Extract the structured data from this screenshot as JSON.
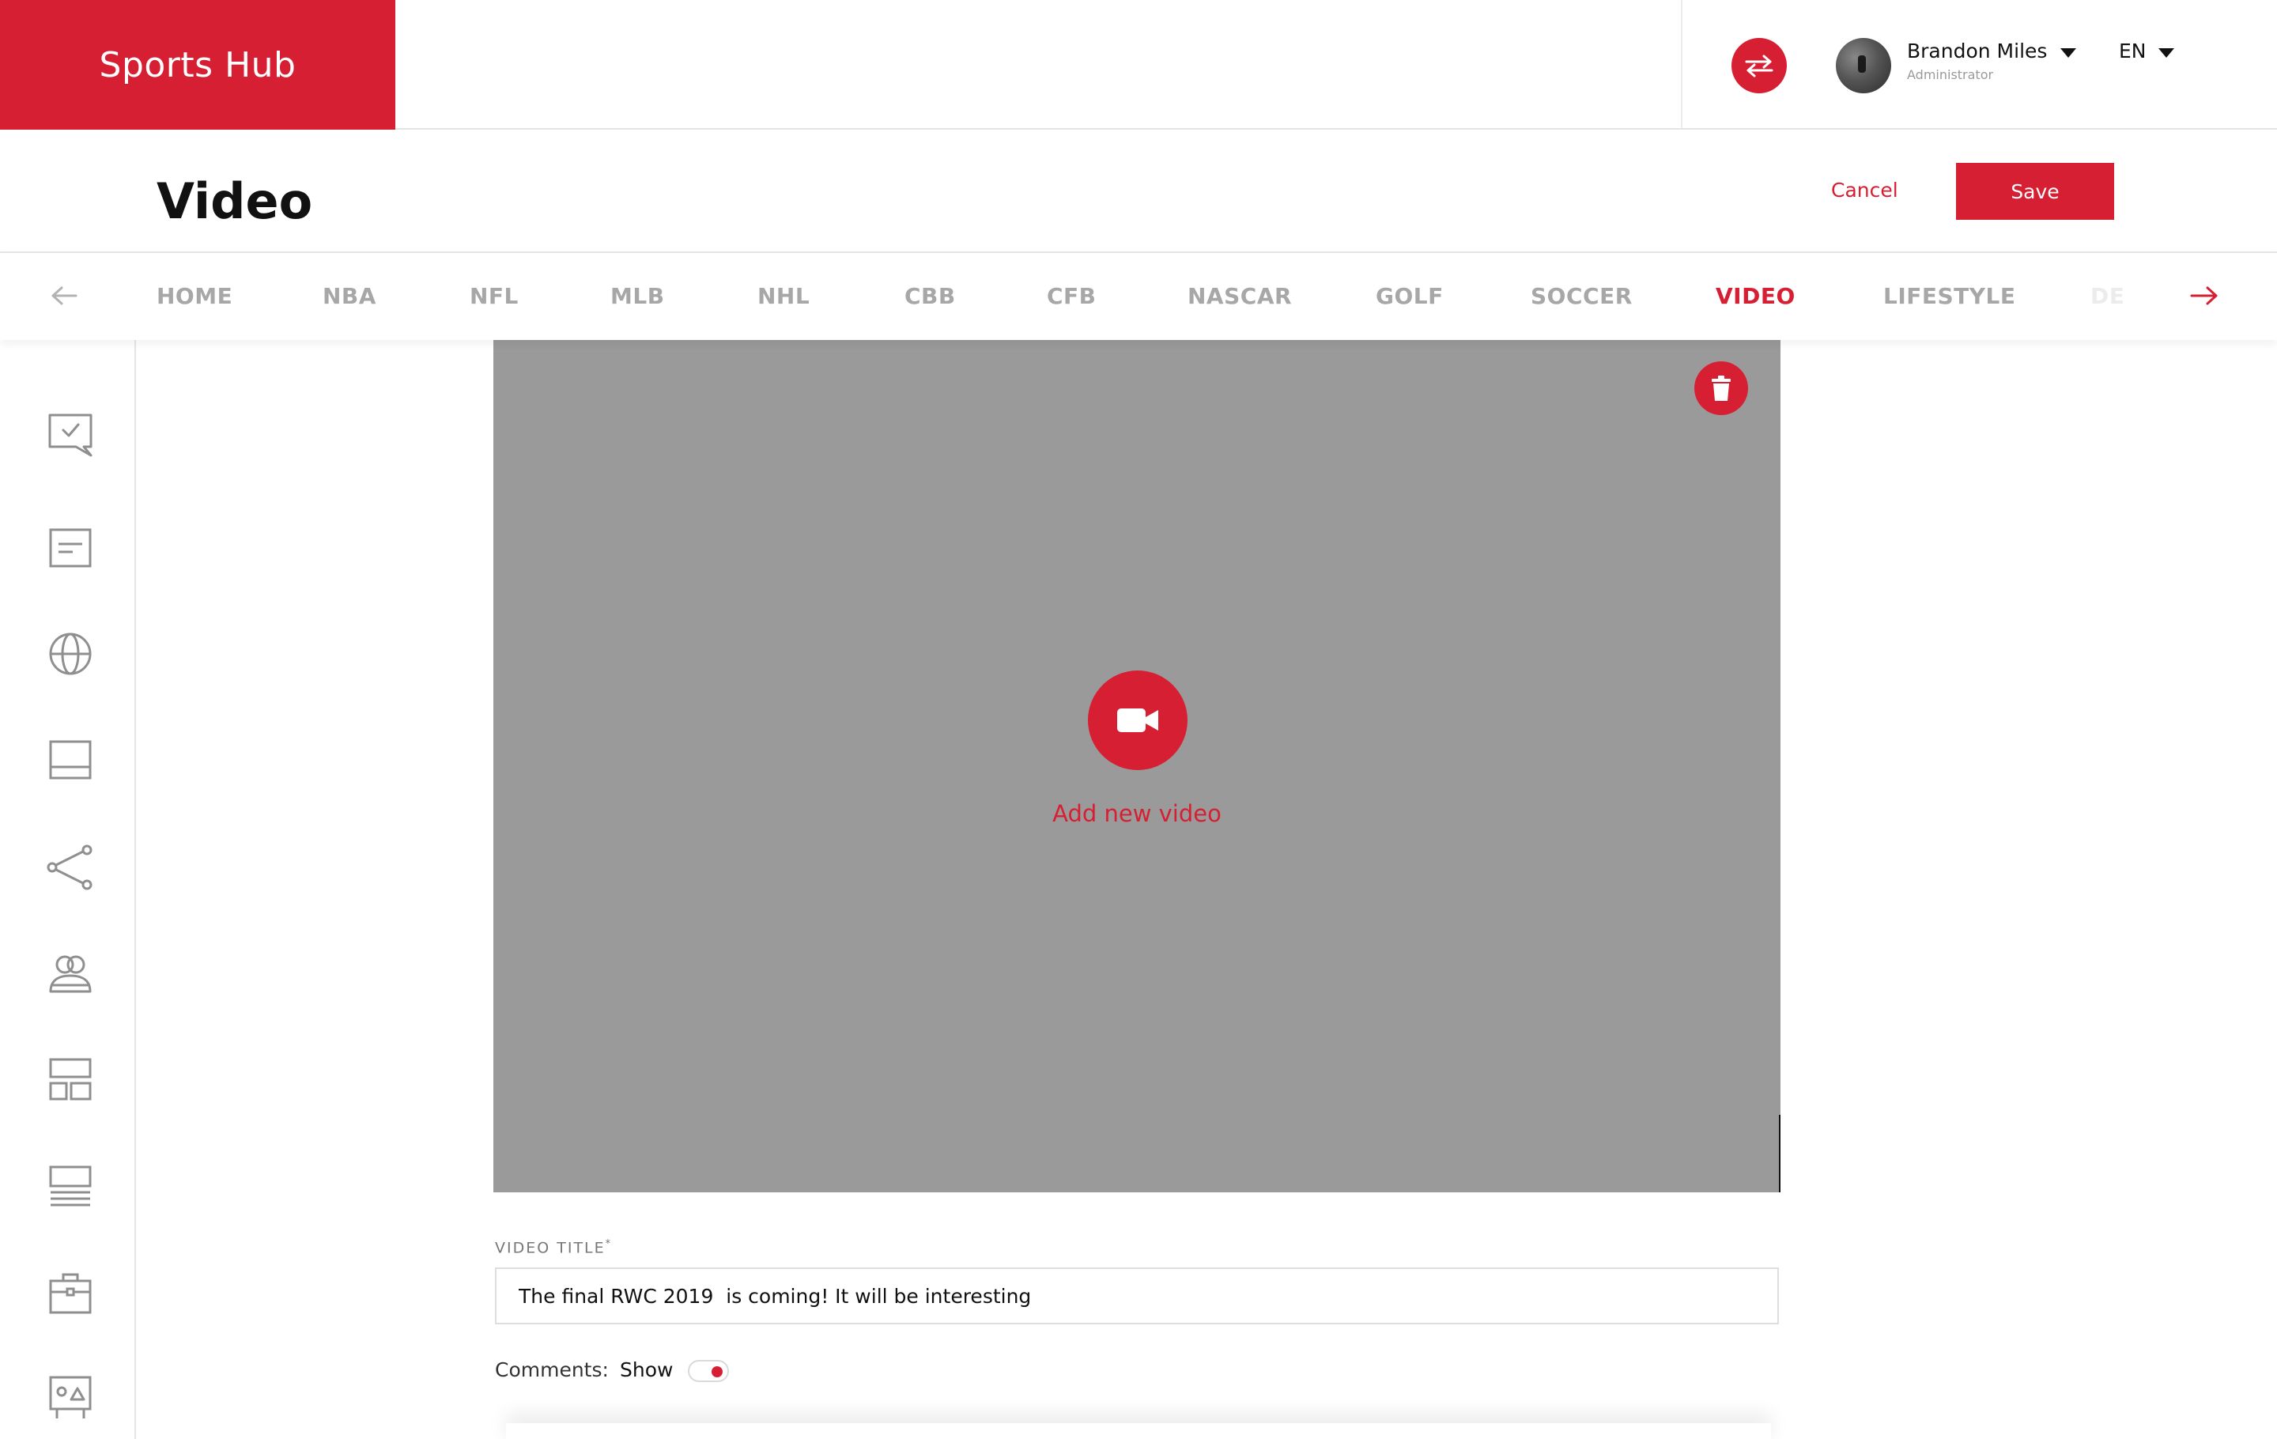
{
  "app": {
    "brand": "Sports Hub"
  },
  "colors": {
    "accent": "#d71f33",
    "video_placeholder": "#9a9a9a"
  },
  "header": {
    "user": {
      "name": "Brandon Miles",
      "role": "Administrator"
    },
    "language": "EN",
    "icons": {
      "swap": "swap-arrows-icon",
      "avatar": "user-avatar",
      "dropdown": "caret-down-icon"
    }
  },
  "page": {
    "title": "Video",
    "cancel_label": "Cancel",
    "save_label": "Save"
  },
  "categories": {
    "items": [
      "HOME",
      "NBA",
      "NFL",
      "MLB",
      "NHL",
      "CBB",
      "CFB",
      "NASCAR",
      "GOLF",
      "SOCCER",
      "VIDEO",
      "LIFESTYLE",
      "DE"
    ],
    "active": "VIDEO",
    "icons": {
      "prev": "arrow-left-icon",
      "next": "arrow-right-icon"
    }
  },
  "sidebar": {
    "icons": [
      "comment-check-icon",
      "article-icon",
      "globe-icon",
      "layout-icon",
      "share-icon",
      "users-icon",
      "blocks-icon",
      "list-icon",
      "briefcase-icon",
      "image-icon"
    ]
  },
  "video": {
    "add_label": "Add new video",
    "icons": {
      "camera": "video-camera-icon",
      "delete": "trash-icon"
    }
  },
  "form": {
    "title_label": "VIDEO TITLE",
    "required_mark": "*",
    "title_value": "The final RWC 2019  is coming! It will be interesting",
    "comments_label": "Comments:",
    "comments_state": "Show",
    "comments_enabled": true
  }
}
